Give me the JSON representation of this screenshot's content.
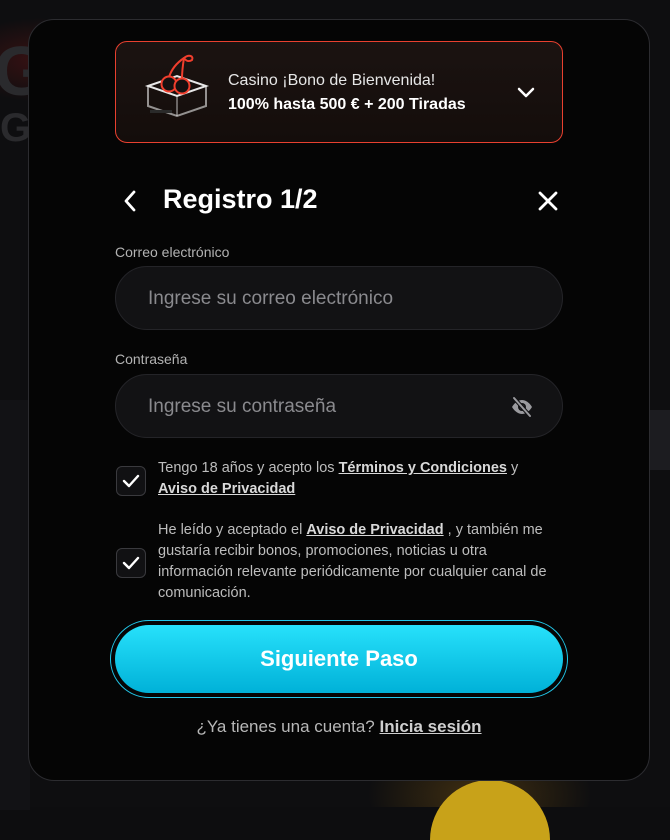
{
  "promo": {
    "title": "Casino ¡Bono de Bienvenida!",
    "subtitle": "100% hasta 500 € + 200 Tiradas",
    "icon": "cherry-box-icon",
    "expand_icon": "chevron-down-icon",
    "accent_color": "#e8402f"
  },
  "header": {
    "title": "Registro 1/2",
    "back_icon": "chevron-left-icon",
    "close_icon": "close-icon"
  },
  "form": {
    "email": {
      "label": "Correo electrónico",
      "placeholder": "Ingrese su correo electrónico",
      "value": ""
    },
    "password": {
      "label": "Contraseña",
      "placeholder": "Ingrese su contraseña",
      "value": "",
      "toggle_icon": "eye-off-icon"
    },
    "consents": [
      {
        "checked": true,
        "text_before": "Tengo 18 años y acepto los ",
        "link1": "Términos y Condiciones",
        "text_middle": " y ",
        "link2": "Aviso de Privacidad",
        "text_after": ""
      },
      {
        "checked": true,
        "text_before": "He leído y aceptado el ",
        "link1": "Aviso de Privacidad",
        "text_after": " , y también me gustaría recibir bonos, promociones, noticias u otra información relevante periódicamente por cualquier canal de comunicación."
      }
    ]
  },
  "actions": {
    "next_label": "Siguiente Paso",
    "primary_color": "#00c3e6"
  },
  "footer": {
    "question": "¿Ya tienes una cuenta?",
    "login_link": "Inicia sesión"
  }
}
